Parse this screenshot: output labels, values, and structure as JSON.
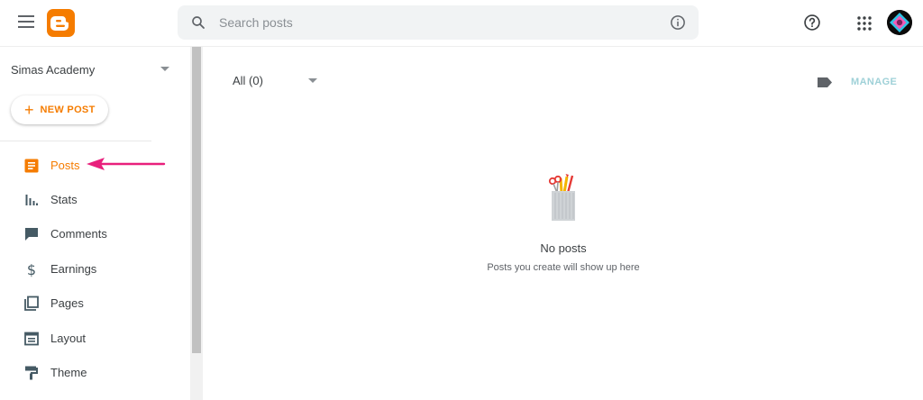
{
  "header": {
    "search_placeholder": "Search posts"
  },
  "sidebar": {
    "blog_name": "Simas Academy",
    "new_post_label": "NEW POST",
    "items": [
      {
        "label": "Posts",
        "icon": "posts-icon",
        "active": true
      },
      {
        "label": "Stats",
        "icon": "stats-icon"
      },
      {
        "label": "Comments",
        "icon": "comments-icon"
      },
      {
        "label": "Earnings",
        "icon": "dollar-icon"
      },
      {
        "label": "Pages",
        "icon": "pages-icon"
      },
      {
        "label": "Layout",
        "icon": "layout-icon"
      },
      {
        "label": "Theme",
        "icon": "theme-icon"
      }
    ]
  },
  "main": {
    "filter_label": "All (0)",
    "manage_label": "MANAGE",
    "empty_title": "No posts",
    "empty_subtitle": "Posts you create will show up here"
  },
  "colors": {
    "accent": "#f57c00",
    "annotation_arrow": "#e8207c",
    "manage_disabled": "#9fd1d8"
  }
}
